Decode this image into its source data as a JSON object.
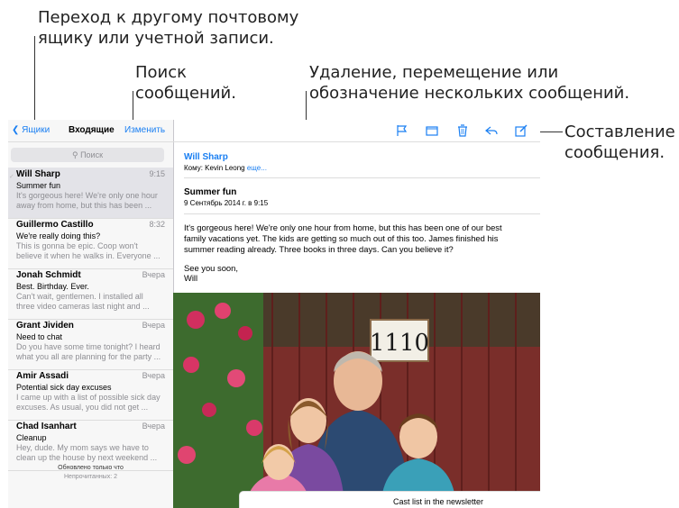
{
  "callouts": {
    "accounts": [
      "Переход к другому почтовому",
      "ящику или учетной записи."
    ],
    "search": [
      "Поиск",
      "сообщений."
    ],
    "bulk": [
      "Удаление, перемещение или",
      "обозначение нескольких сообщений."
    ],
    "compose": [
      "Составление",
      "сообщения."
    ]
  },
  "sidebar": {
    "back_label": "Ящики",
    "title": "Входящие",
    "edit_label": "Изменить",
    "search_placeholder": "Поиск",
    "messages": [
      {
        "from": "Will Sharp",
        "time": "9:15",
        "subject": "Summer fun",
        "preview": [
          "It's gorgeous here! We're only one hour",
          "away from home, but this has been ..."
        ]
      },
      {
        "from": "Guillermo Castillo",
        "time": "8:32",
        "subject": "We're really doing this?",
        "preview": [
          "This is gonna be epic. Coop won't",
          "believe it when he walks in. Everyone ..."
        ]
      },
      {
        "from": "Jonah Schmidt",
        "time": "Вчера",
        "subject": "Best. Birthday. Ever.",
        "preview": [
          "Can't wait, gentlemen. I installed all",
          "three video cameras last night and ..."
        ]
      },
      {
        "from": "Grant Jividen",
        "time": "Вчера",
        "subject": "Need to chat",
        "preview": [
          "Do you have some time tonight? I heard",
          "what you all are planning for the party ..."
        ]
      },
      {
        "from": "Amir Assadi",
        "time": "Вчера",
        "subject": "Potential sick day excuses",
        "preview": [
          "I came up with a list of possible sick day",
          "excuses. As usual, you did not get ..."
        ]
      },
      {
        "from": "Chad Isanhart",
        "time": "Вчера",
        "subject": "Cleanup",
        "preview": [
          "Hey, dude. My mom says we have to",
          "clean up the house by next weekend ..."
        ]
      }
    ],
    "updated": "Обновлено только что",
    "unread": "Непрочитанных: 2"
  },
  "detail": {
    "sender": "Will Sharp",
    "to_label": "Кому: Kevin Leong",
    "more_label": "еще...",
    "subject": "Summer fun",
    "date": "9 Сентябрь 2014 г. в 9:15",
    "body": "It's gorgeous here! We're only one hour from home, but this has been one of our best family vacations yet. The kids are getting so much out of this too. James finished his summer reading already. Three books in three days. Can you believe it?",
    "closing": "See you soon,",
    "signature": "Will",
    "photo_sign": "1110",
    "popup_title": "Cast list in the newsletter"
  },
  "toolbar_icons": [
    "flag-icon",
    "folder-icon",
    "trash-icon",
    "reply-icon",
    "compose-icon"
  ],
  "colors": {
    "accent": "#1a7ff2",
    "sidebar_bg": "#f7f7f7",
    "selected_row": "#e3e3e8"
  }
}
